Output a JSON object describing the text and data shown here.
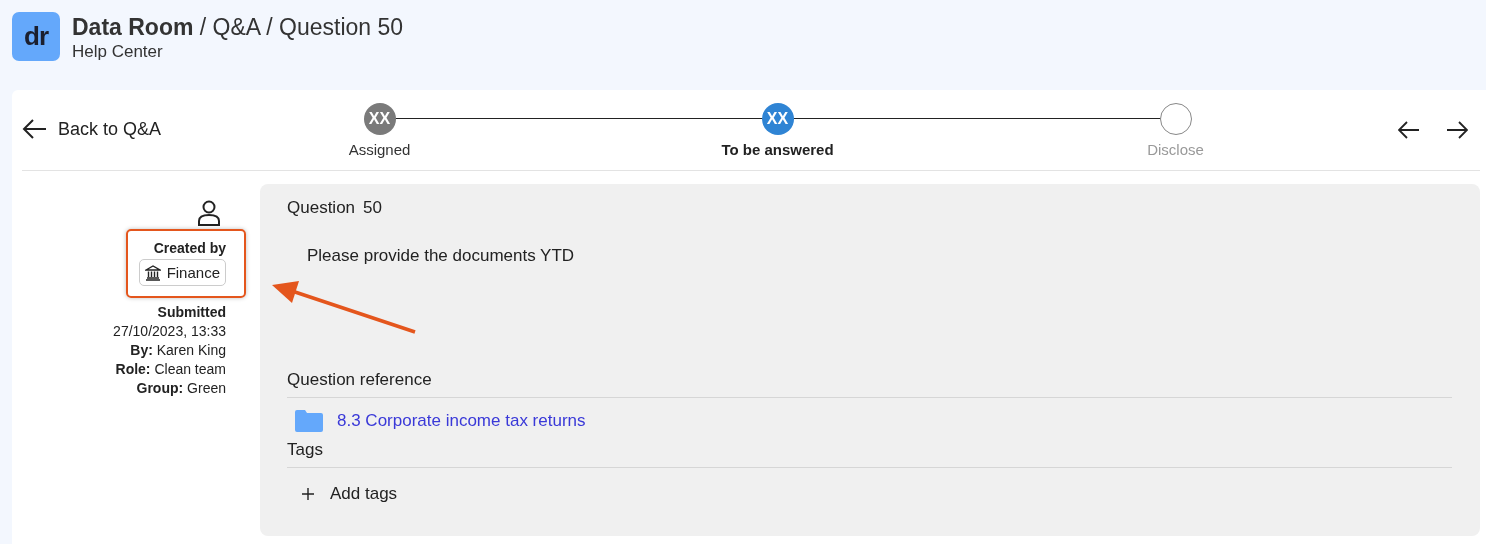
{
  "header": {
    "logo": "dr",
    "title": "**Data Room** / Q&A / Question 50",
    "subtitle": "Help Center"
  },
  "back_link": "Back to Q&A",
  "steps": [
    {
      "kind": "done",
      "badge": "XX",
      "label": "Assigned"
    },
    {
      "kind": "current",
      "badge": "XX",
      "label": "To be answered"
    },
    {
      "kind": "upcoming",
      "label": "Disclose"
    }
  ],
  "sidebar": {
    "created_by_label": "Created by",
    "created_by": "Finance",
    "submitted_label": "Submitted",
    "submitted_at": "27/10/2023, 13:33",
    "details": [
      "**By:** Karen King",
      "**Role:** Clean team",
      "**Group:** Green"
    ]
  },
  "question": {
    "label": "Question",
    "number": "50",
    "text": "Please provide the documents YTD",
    "reference_label": "Question reference",
    "reference": "8.3 Corporate income tax returns",
    "tags_label": "Tags",
    "add_tags": "Add tags"
  },
  "annotation": {
    "highlight_box": true,
    "arrow": true
  }
}
